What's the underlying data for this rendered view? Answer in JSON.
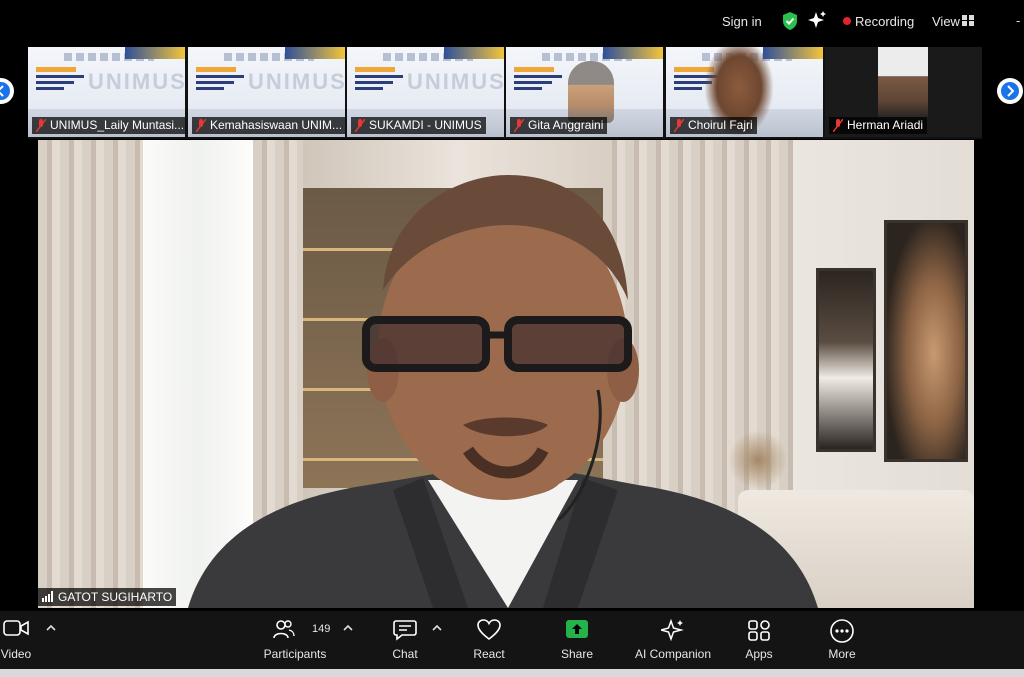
{
  "topbar": {
    "sign_in": "Sign in",
    "recording": "Recording",
    "view": "View",
    "icons": [
      "shield-check-icon",
      "sparkle-icon",
      "recording-dot-icon",
      "grid-icon"
    ],
    "colors": {
      "shield": "#2bbf4c",
      "recording_dot": "#e0242b"
    }
  },
  "thumbnails": [
    {
      "name": "UNIMUS_Laily Muntasi..."
    },
    {
      "name": "Kemahasiswaan UNIM..."
    },
    {
      "name": "SUKAMDI - UNIMUS"
    },
    {
      "name": "Gita Anggraini"
    },
    {
      "name": "Choirul Fajri"
    },
    {
      "name": "Herman Ariadi"
    }
  ],
  "slide": {
    "watermark": "UNIMUS"
  },
  "speaker": {
    "name": "GATOT SUGIHARTO"
  },
  "toolbar": {
    "video": "Video",
    "participants": "Participants",
    "participants_count": "149",
    "chat": "Chat",
    "react": "React",
    "share": "Share",
    "ai_companion": "AI Companion",
    "apps": "Apps",
    "more": "More",
    "share_color": "#24b24b"
  }
}
